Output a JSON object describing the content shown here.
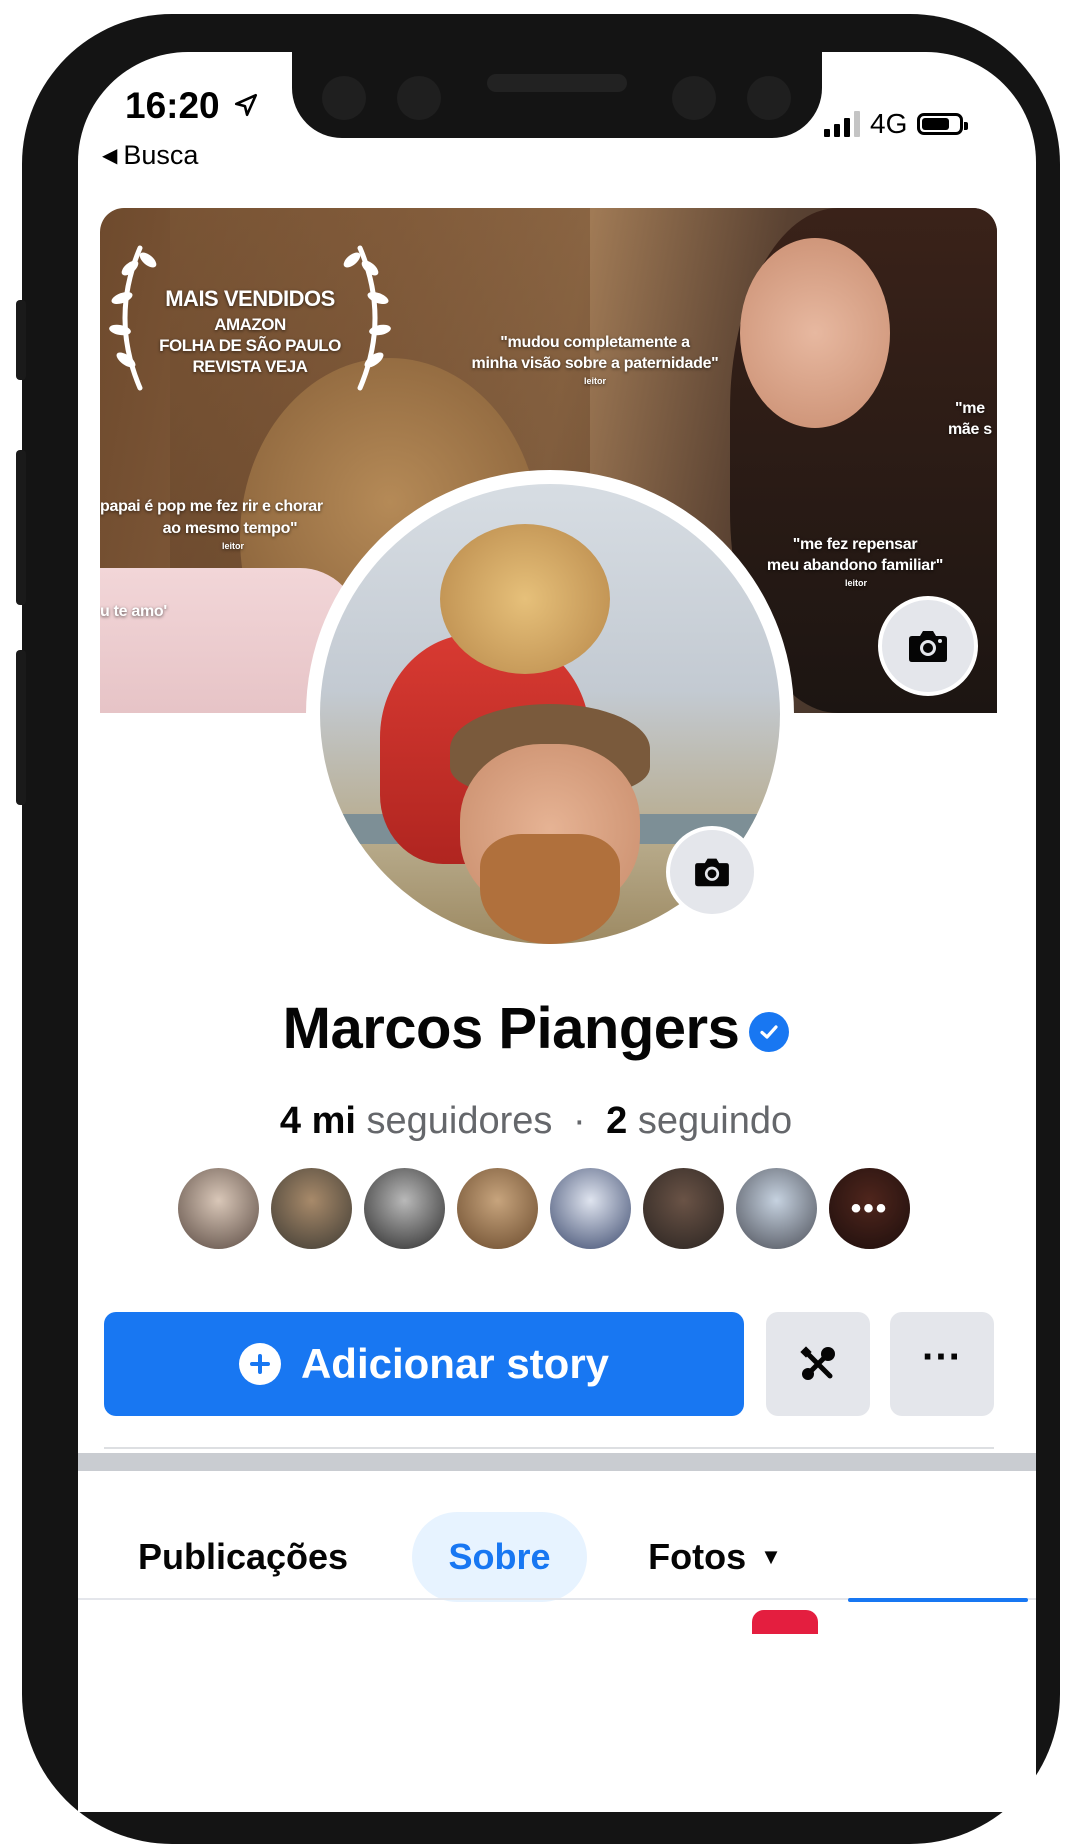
{
  "status_bar": {
    "time": "16:20",
    "back_label": "Busca",
    "network": "4G"
  },
  "cover": {
    "award_title": "MAIS VENDIDOS",
    "award_lines": [
      "AMAZON",
      "FOLHA DE SÃO PAULO",
      "REVISTA VEJA"
    ],
    "quote_1_line1": "\"mudou completamente a",
    "quote_1_line2": "minha visão sobre a paternidade\"",
    "quote_1_author": "leitor",
    "quote_2_line1": "papai é pop me fez rir e chorar",
    "quote_2_line2": "ao mesmo tempo\"",
    "quote_2_author": "leitor",
    "quote_3": "u te amo'",
    "quote_4_line1": "\"me fez repensar",
    "quote_4_line2": "meu abandono familiar\"",
    "quote_4_author": "leitor",
    "quote_5_line1": "\"me",
    "quote_5_line2": "mãe s"
  },
  "profile": {
    "name": "Marcos Piangers",
    "followers_count": "4 mi",
    "followers_label": "seguidores",
    "separator": "·",
    "following_count": "2",
    "following_label": "seguindo",
    "friend_avatars": [
      {
        "colors": [
          "#d9c7b8",
          "#5a4a42"
        ]
      },
      {
        "colors": [
          "#a88a6a",
          "#3d3a33"
        ]
      },
      {
        "colors": [
          "#b9b9b9",
          "#2a2a2a"
        ]
      },
      {
        "colors": [
          "#c7a47d",
          "#6a4a2c"
        ]
      },
      {
        "colors": [
          "#dfe4ef",
          "#3c4a6e"
        ]
      },
      {
        "colors": [
          "#6a5346",
          "#2a2421"
        ]
      },
      {
        "colors": [
          "#c6d2e0",
          "#4b4e57"
        ]
      },
      {
        "colors": [
          "#7a3a2c",
          "#2c1614"
        ]
      }
    ],
    "more_label": "•••"
  },
  "actions": {
    "add_story_label": "Adicionar story",
    "more_label": "···"
  },
  "tabs": {
    "posts": "Publicações",
    "about": "Sobre",
    "photos": "Fotos",
    "photos_caret": "▼"
  },
  "colors": {
    "accent": "#1877f2",
    "button_gray": "#e4e6eb",
    "text_primary": "#050505",
    "text_secondary": "#65676b"
  }
}
